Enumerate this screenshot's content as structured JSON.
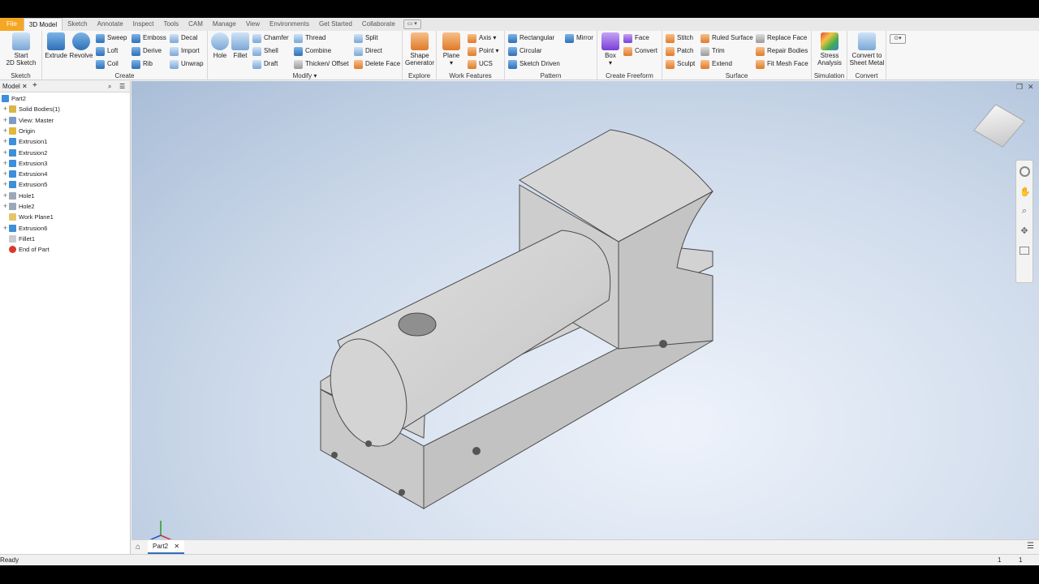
{
  "tabs": [
    "File",
    "3D Model",
    "Sketch",
    "Annotate",
    "Inspect",
    "Tools",
    "CAM",
    "Manage",
    "View",
    "Environments",
    "Get Started",
    "Collaborate"
  ],
  "ribbon": {
    "sketch": {
      "label": "Sketch",
      "start": "Start",
      "start2": "2D Sketch"
    },
    "create": {
      "label": "Create",
      "extrude": "Extrude",
      "revolve": "Revolve",
      "sweep": "Sweep",
      "loft": "Loft",
      "coil": "Coil",
      "emboss": "Emboss",
      "derive": "Derive",
      "rib": "Rib",
      "decal": "Decal",
      "import": "Import",
      "unwrap": "Unwrap"
    },
    "modify": {
      "label": "Modify",
      "hole": "Hole",
      "fillet": "Fillet",
      "chamfer": "Chamfer",
      "shell": "Shell",
      "draft": "Draft",
      "thread": "Thread",
      "combine": "Combine",
      "thicken": "Thicken/ Offset",
      "split": "Split",
      "direct": "Direct",
      "delete_face": "Delete Face"
    },
    "explore": {
      "label": "Explore",
      "shape": "Shape",
      "generator": "Generator"
    },
    "work": {
      "label": "Work Features",
      "plane": "Plane",
      "axis": "Axis",
      "point": "Point",
      "ucs": "UCS"
    },
    "pattern": {
      "label": "Pattern",
      "rectangular": "Rectangular",
      "circular": "Circular",
      "sketch_driven": "Sketch Driven",
      "mirror": "Mirror"
    },
    "freeform": {
      "label": "Create Freeform",
      "box": "Box",
      "face": "Face",
      "convert": "Convert"
    },
    "surface": {
      "label": "Surface",
      "stitch": "Stitch",
      "patch": "Patch",
      "sculpt": "Sculpt",
      "ruled": "Ruled Surface",
      "trim": "Trim",
      "extend": "Extend",
      "replace": "Replace Face",
      "repair": "Repair Bodies",
      "fit_mesh": "Fit Mesh Face"
    },
    "simulation": {
      "label": "Simulation",
      "stress": "Stress",
      "analysis": "Analysis"
    },
    "convert": {
      "label": "Convert",
      "to": "Convert to",
      "sheet": "Sheet Metal"
    }
  },
  "browser": {
    "title": "Model",
    "items": [
      "Part2",
      "Solid Bodies(1)",
      "View: Master",
      "Origin",
      "Extrusion1",
      "Extrusion2",
      "Extrusion3",
      "Extrusion4",
      "Extrusion5",
      "Hole1",
      "Hole2",
      "Work Plane1",
      "Extrusion6",
      "Fillet1",
      "End of Part"
    ]
  },
  "doc_tab": "Part2",
  "status": {
    "text": "Ready",
    "n1": "1",
    "n2": "1"
  },
  "colors": {
    "file_tab": "#f5a623",
    "accent": "#2f6fb5"
  }
}
